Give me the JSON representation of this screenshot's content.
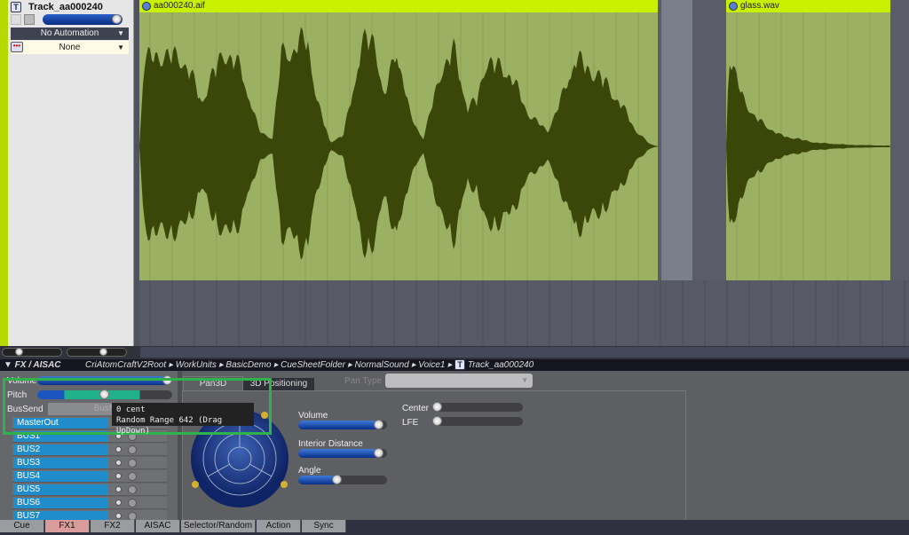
{
  "track": {
    "name": "Track_aa000240",
    "automation": "No Automation",
    "sequence": "None",
    "volume": 0.95
  },
  "clips": [
    {
      "name": "aa000240.aif"
    },
    {
      "name": "glass.wav"
    }
  ],
  "colors": {
    "lime": "#b6d900",
    "clip": "#9bb063",
    "waveform": "#3b4709",
    "highlight": "#2db34a"
  },
  "breadcrumb": {
    "panel": "▼ FX / AISAC",
    "items": [
      "CriAtomCraftV2Root",
      "WorkUnits",
      "BasicDemo",
      "CueSheetFolder",
      "NormalSound",
      "Voice1",
      "Track_aa000240"
    ]
  },
  "fx": {
    "volume_label": "Volume",
    "pitch_label": "Pitch",
    "bussend_label": "BusSend",
    "busmap_label": "BusMap",
    "buses": [
      "MasterOut",
      "BUS1",
      "BUS2",
      "BUS3",
      "BUS4",
      "BUS5",
      "BUS6",
      "BUS7"
    ]
  },
  "tooltip": {
    "line1": "0 cent",
    "line2": "Random Range 642 (Drag UpDown)"
  },
  "pan": {
    "tabs": [
      "Pan3D",
      "3D Positioning"
    ],
    "pan_type_label": "Pan Type",
    "pan_type_value": "",
    "volume_label": "Volume",
    "volume": 0.95,
    "interior_label": "Interior Distance",
    "interior": 0.95,
    "angle_label": "Angle",
    "angle": 0.48,
    "center_label": "Center",
    "center": 0,
    "lfe_label": "LFE",
    "lfe": 0
  },
  "tabs": [
    {
      "label": "Cue"
    },
    {
      "label": "FX1",
      "active": true
    },
    {
      "label": "FX2"
    },
    {
      "label": "AISAC"
    },
    {
      "label": "Selector/Random"
    },
    {
      "label": "Action"
    },
    {
      "label": "Sync"
    }
  ]
}
